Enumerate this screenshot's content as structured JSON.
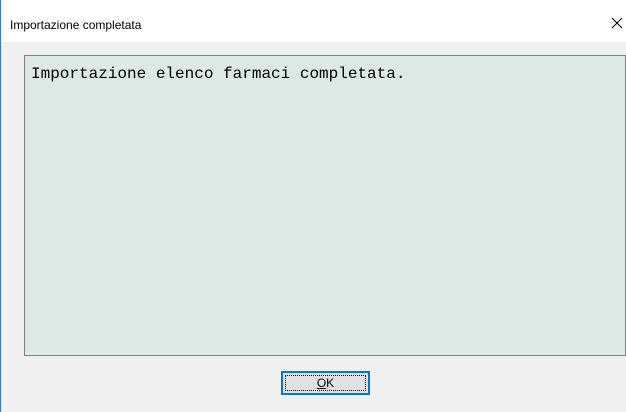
{
  "window": {
    "title": "Importazione completata",
    "close_icon": "close-icon"
  },
  "message": {
    "text": "Importazione elenco farmaci completata."
  },
  "buttons": {
    "ok": {
      "mnemonic": "O",
      "rest": "K"
    }
  },
  "colors": {
    "message_background": "#dce9e7",
    "window_background": "#f0f0f0",
    "focus_border": "#0078d7",
    "window_border": "#2b79d6"
  }
}
